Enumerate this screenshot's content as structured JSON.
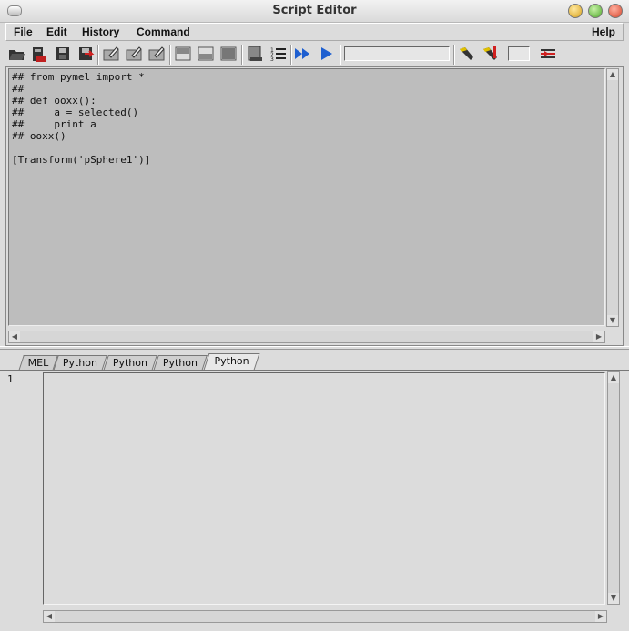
{
  "window": {
    "title": "Script Editor"
  },
  "menu": {
    "file": "File",
    "edit": "Edit",
    "history": "History",
    "command": "Command",
    "help": "Help"
  },
  "toolbar": {
    "icons": [
      "open-script-icon",
      "source-script-icon",
      "save-script-icon",
      "save-script-to-shelf-icon",
      "echo-all-commands-icon",
      "show-line-numbers-history-icon",
      "show-stack-trace-icon",
      "clear-history-icon",
      "clear-input-icon",
      "clear-all-icon",
      "show-history-only-icon",
      "show-line-numbers-icon",
      "execute-all-icon",
      "execute-icon",
      "search-icon",
      "search-replace-icon",
      "go-to-line-icon"
    ],
    "search_value": "",
    "line_value": ""
  },
  "history": {
    "text": "## from pymel import *\n##\n## def ooxx():\n##     a = selected()\n##     print a\n## ooxx()\n\n[Transform('pSphere1')]\n"
  },
  "tabs": [
    {
      "label": "MEL",
      "active": false
    },
    {
      "label": "Python",
      "active": false
    },
    {
      "label": "Python",
      "active": false
    },
    {
      "label": "Python",
      "active": false
    },
    {
      "label": "Python",
      "active": true
    }
  ],
  "input": {
    "line_number": "1",
    "text": ""
  }
}
